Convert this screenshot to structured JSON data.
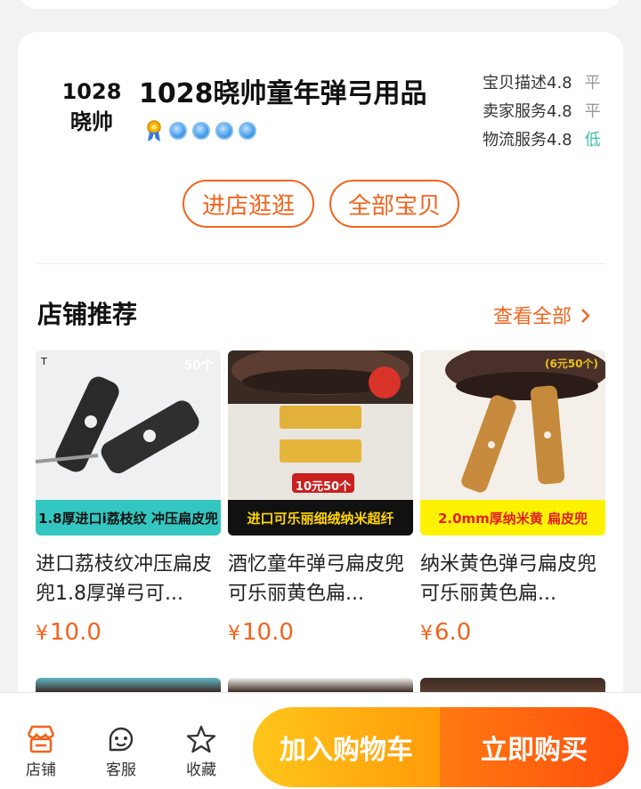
{
  "shop": {
    "logo_line1": "1028",
    "logo_line2": "晓帅",
    "name": "1028晓帅童年弹弓用品",
    "ratings": [
      {
        "label": "宝贝描述4.8",
        "level": "平"
      },
      {
        "label": "卖家服务4.8",
        "level": "平"
      },
      {
        "label": "物流服务4.8",
        "level": "低"
      }
    ],
    "enter_shop": "进店逛逛",
    "all_items": "全部宝贝"
  },
  "recommend": {
    "title": "店铺推荐",
    "view_all": "查看全部"
  },
  "products": [
    {
      "title": "进口荔枝纹冲压扁皮兜1.8厚弹弓可...",
      "currency": "¥",
      "price": "10.0",
      "banner": "1.8厚进口i荔枝纹 冲压扁皮兜",
      "corner": "50个",
      "colors": {
        "bg": "#eef0f2",
        "banner_bg": "#34c6c0",
        "banner_fg": "#111111"
      }
    },
    {
      "title": "酒忆童年弹弓扁皮兜可乐丽黄色扁...",
      "currency": "¥",
      "price": "10.0",
      "banner": "进口可乐丽细绒纳米超纤",
      "corner": "",
      "sub": "10元50个",
      "colors": {
        "bg": "#3a2a24",
        "banner_bg": "#111111",
        "banner_fg": "#ffd400"
      }
    },
    {
      "title": "纳米黄色弹弓扁皮兜可乐丽黄色扁...",
      "currency": "¥",
      "price": "6.0",
      "banner": "2.0mm厚纳米黄 扁皮兜",
      "corner": "(6元50个)",
      "colors": {
        "bg": "#f4efe8",
        "banner_bg": "#fff200",
        "banner_fg": "#e0202a"
      }
    }
  ],
  "bottom_bar": {
    "tabs": [
      {
        "label": "店铺",
        "icon": "store-icon"
      },
      {
        "label": "客服",
        "icon": "customer-service-icon"
      },
      {
        "label": "收藏",
        "icon": "star-icon"
      }
    ],
    "add_to_cart": "加入购物车",
    "buy_now": "立即购买"
  },
  "colors": {
    "accent": "#f0641e",
    "low": "#3cbfa5"
  }
}
